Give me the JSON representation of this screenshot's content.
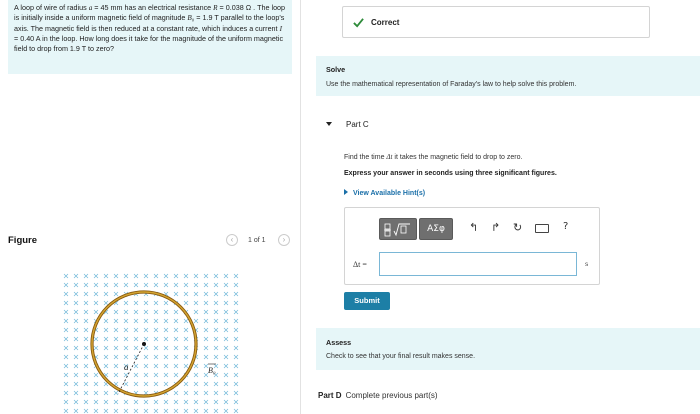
{
  "problem": {
    "text_parts": [
      "A loop of wire of radius ",
      "a",
      " = 45 mm has an electrical resistance ",
      "R",
      " = 0.038 Ω . The loop is initially inside a uniform magnetic field of magnitude ",
      "B₀",
      " = 1.9 T parallel to the loop's axis. The magnetic field is then reduced at a constant rate, which induces a current ",
      "I",
      " = 0.40 A in the loop. How long does it take for the magnitude of the uniform magnetic field to drop from 1.9 T to zero?"
    ]
  },
  "figure": {
    "title": "Figure",
    "pager": "1 of 1",
    "prev_icon": "chevron-left-icon",
    "next_icon": "chevron-right-icon",
    "radius_label": "a",
    "field_label": "B₀"
  },
  "feedback": {
    "label": "Correct",
    "icon": "check-icon",
    "color": "#2e8b3a"
  },
  "solve": {
    "title": "Solve",
    "text": "Use the mathematical representation of Faraday's law to help solve this problem."
  },
  "part_c": {
    "label": "Part C",
    "find_prefix": "Find the time ",
    "find_var": "Δt",
    "find_suffix": " it takes the magnetic field to drop to zero.",
    "instruction": "Express your answer in seconds using three significant figures.",
    "hint_link": "View Available Hint(s)",
    "toolbar": {
      "template_icon": "fraction-sqrt-icon",
      "symbols_label": "ΑΣφ",
      "undo_icon": "undo-icon",
      "redo_icon": "redo-icon",
      "reset_icon": "reset-icon",
      "keyboard_icon": "keyboard-icon",
      "help_label": "?"
    },
    "input_label": "Δt =",
    "input_value": "",
    "unit": "s",
    "submit_label": "Submit"
  },
  "assess": {
    "title": "Assess",
    "text": "Check to see that your final result makes sense."
  },
  "part_d": {
    "label": "Part D",
    "status": "Complete previous part(s)"
  },
  "colors": {
    "band": "#e6f6f8",
    "accent": "#1d7fa6",
    "loop": "#b8860b",
    "field_marks": "#6fb8d8"
  }
}
